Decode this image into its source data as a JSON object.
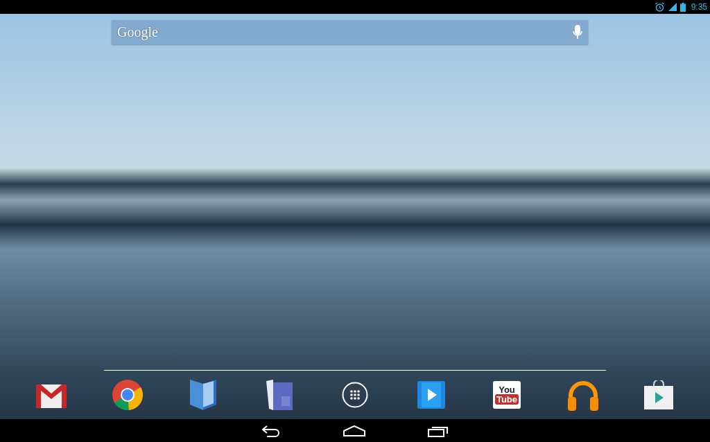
{
  "status_bar": {
    "time": "9:35"
  },
  "search": {
    "logo": "Google"
  },
  "dock": [
    {
      "kind": "gmail"
    },
    {
      "kind": "chrome"
    },
    {
      "kind": "books"
    },
    {
      "kind": "magazines"
    },
    {
      "kind": "apps"
    },
    {
      "kind": "movies"
    },
    {
      "kind": "youtube",
      "top": "You",
      "bottom": "Tube"
    },
    {
      "kind": "music"
    },
    {
      "kind": "store"
    }
  ],
  "nav_bar": [
    {
      "kind": "back"
    },
    {
      "kind": "home"
    },
    {
      "kind": "recent"
    }
  ]
}
